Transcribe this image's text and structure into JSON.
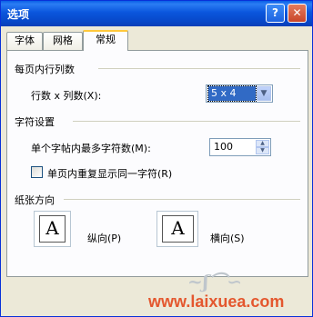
{
  "window": {
    "title": "选项",
    "help_icon": "?",
    "close_icon": "✕"
  },
  "tabs": [
    {
      "label": "字体"
    },
    {
      "label": "网格"
    },
    {
      "label": "常规"
    }
  ],
  "groups": {
    "per_page": {
      "title": "每页内行列数",
      "label": "行数 x 列数(X):",
      "value": "5 x 4"
    },
    "chars": {
      "title": "字符设置",
      "max_label": "单个字帖内最多字符数(M):",
      "max_value": "100",
      "repeat_label": "单页内重复显示同一字符(R)"
    },
    "orientation": {
      "title": "纸张方向",
      "portrait": "纵向(P)",
      "landscape": "横向(S)",
      "glyph": "A"
    }
  },
  "watermark": "www.laixuea.com"
}
